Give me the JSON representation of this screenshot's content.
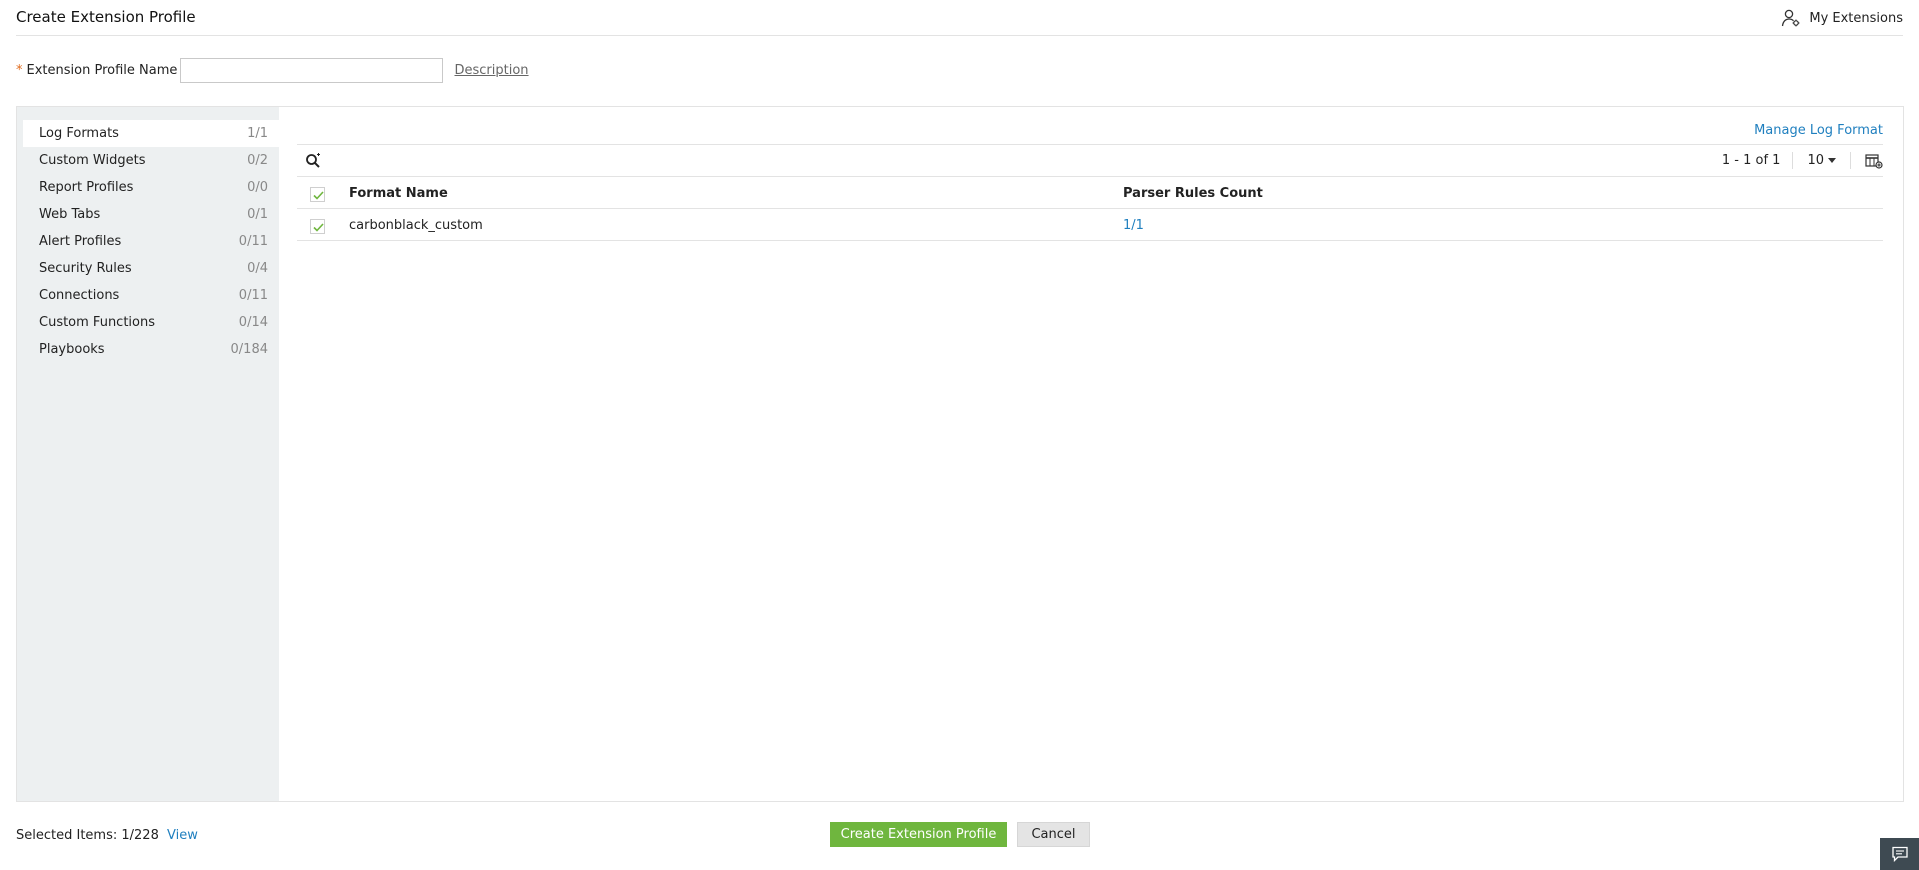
{
  "header": {
    "title": "Create Extension Profile",
    "my_extensions_label": "My Extensions",
    "my_extensions_icon": "user-settings-icon"
  },
  "form": {
    "required_marker": "*",
    "name_label": "Extension Profile Name",
    "name_value": "",
    "description_link": "Description"
  },
  "sidebar": {
    "items": [
      {
        "label": "Log Formats",
        "count": "1/1",
        "active": true
      },
      {
        "label": "Custom Widgets",
        "count": "0/2"
      },
      {
        "label": "Report Profiles",
        "count": "0/0"
      },
      {
        "label": "Web Tabs",
        "count": "0/1"
      },
      {
        "label": "Alert Profiles",
        "count": "0/11"
      },
      {
        "label": "Security Rules",
        "count": "0/4"
      },
      {
        "label": "Connections",
        "count": "0/11"
      },
      {
        "label": "Custom Functions",
        "count": "0/14"
      },
      {
        "label": "Playbooks",
        "count": "0/184"
      }
    ]
  },
  "content": {
    "manage_link": "Manage Log Format",
    "pager": {
      "range": "1 - 1 of 1",
      "per_page": "10"
    },
    "table": {
      "columns": [
        "Format Name",
        "Parser Rules Count"
      ],
      "header_checked": true,
      "rows": [
        {
          "checked": true,
          "format_name": "carbonblack_custom",
          "parser_rules_count": "1/1"
        }
      ]
    }
  },
  "footer": {
    "selected_label": "Selected Items:",
    "selected_value": "1/228",
    "view_link": "View",
    "create_button": "Create Extension Profile",
    "cancel_button": "Cancel"
  },
  "colors": {
    "accent_link": "#1f7fbf",
    "primary_button": "#6fb63e",
    "sidebar_bg": "#edf0f1",
    "check_green": "#6fb63e",
    "required": "#e06a1b"
  }
}
